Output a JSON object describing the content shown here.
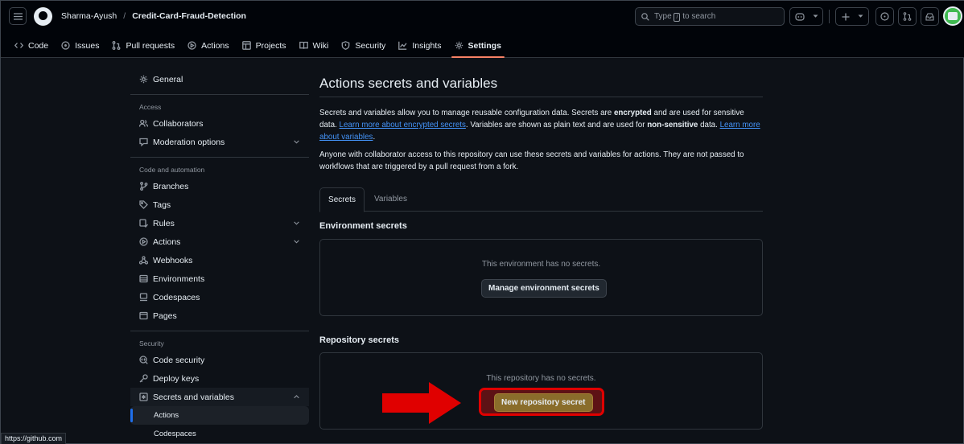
{
  "header": {
    "owner": "Sharma-Ayush",
    "separator": "/",
    "repo": "Credit-Card-Fraud-Detection",
    "search": {
      "prefix": "Type",
      "key": "/",
      "suffix": "to search"
    }
  },
  "repo_nav": [
    {
      "label": "Code",
      "icon": "code-icon"
    },
    {
      "label": "Issues",
      "icon": "issue-icon"
    },
    {
      "label": "Pull requests",
      "icon": "pull-request-icon"
    },
    {
      "label": "Actions",
      "icon": "play-icon"
    },
    {
      "label": "Projects",
      "icon": "table-icon"
    },
    {
      "label": "Wiki",
      "icon": "book-icon"
    },
    {
      "label": "Security",
      "icon": "shield-icon"
    },
    {
      "label": "Insights",
      "icon": "graph-icon"
    },
    {
      "label": "Settings",
      "icon": "gear-icon",
      "active": true
    }
  ],
  "sidebar": {
    "general": "General",
    "access_heading": "Access",
    "access": [
      "Collaborators",
      "Moderation options"
    ],
    "code_heading": "Code and automation",
    "code": [
      "Branches",
      "Tags",
      "Rules",
      "Actions",
      "Webhooks",
      "Environments",
      "Codespaces",
      "Pages"
    ],
    "security_heading": "Security",
    "security": [
      "Code security",
      "Deploy keys",
      "Secrets and variables"
    ],
    "sub_items": [
      "Actions",
      "Codespaces"
    ]
  },
  "main": {
    "title": "Actions secrets and variables",
    "p1": {
      "t1": "Secrets and variables allow you to manage reusable configuration data. Secrets are ",
      "b1": "encrypted",
      "t2": " and are used for sensitive data. ",
      "link1": "Learn more about encrypted secrets",
      "t3": ". Variables are shown as plain text and are used for ",
      "b2": "non-sensitive",
      "t4": " data. ",
      "link2": "Learn more about variables",
      "t5": "."
    },
    "p2": "Anyone with collaborator access to this repository can use these secrets and variables for actions. They are not passed to workflows that are triggered by a pull request from a fork.",
    "tabs": [
      "Secrets",
      "Variables"
    ],
    "env_title": "Environment secrets",
    "env_empty": "This environment has no secrets.",
    "env_button": "Manage environment secrets",
    "repo_title": "Repository secrets",
    "repo_empty": "This repository has no secrets.",
    "repo_button": "New repository secret"
  },
  "status_url": "https://github.com",
  "colors": {
    "accent_underline": "#f78166",
    "link": "#4493f8",
    "highlight_red": "#e00000"
  }
}
